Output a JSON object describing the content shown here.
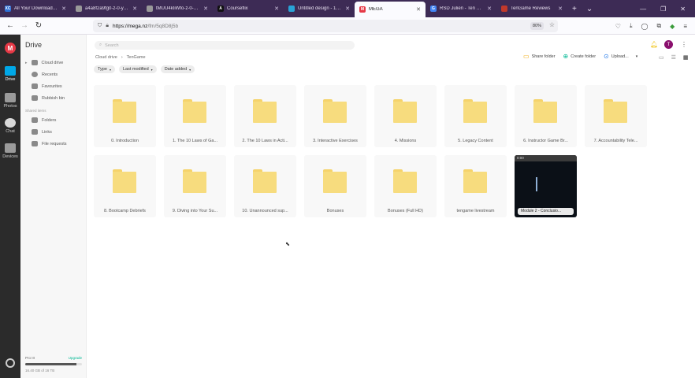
{
  "browser": {
    "tabs": [
      {
        "favicon": "XC",
        "fav_color": "#2c6fd6",
        "title": "All Your Downloadable Eb",
        "active": false
      },
      {
        "favicon": "",
        "fav_color": "#999999",
        "title": "a4a8f2a9fg0-z-0-y-668ad4fa0",
        "active": false
      },
      {
        "favicon": "",
        "fav_color": "#999999",
        "title": "tMUU4kIiWfo-z-0-y-666ad2c",
        "active": false
      },
      {
        "favicon": "A",
        "fav_color": "#111111",
        "title": "Courseflix",
        "active": false
      },
      {
        "favicon": "",
        "fav_color": "#29a3d6",
        "title": "Untitled design - 1200 x",
        "active": false
      },
      {
        "favicon": "M",
        "fav_color": "#e63946",
        "title": "MEGA",
        "active": true
      },
      {
        "favicon": "G",
        "fav_color": "#4285f4",
        "title": "RSD Julien - Ten Game - C",
        "active": false
      },
      {
        "favicon": "",
        "fav_color": "#c0392b",
        "title": "TenGame Reviews",
        "active": false
      }
    ],
    "new_tab": "+",
    "tab_list": "⌄",
    "url_host": "https://mega.nz",
    "url_rest": "/fm/5q8D8j5b",
    "zoom": "80%"
  },
  "rail": {
    "logo": "M",
    "items": [
      {
        "label": "Drive",
        "color": "#00a8e8"
      },
      {
        "label": "Photos",
        "color": "#9a9a9a"
      },
      {
        "label": "Chat",
        "color": "#9a9a9a"
      },
      {
        "label": "Devices",
        "color": "#9a9a9a"
      }
    ]
  },
  "sidebar": {
    "title": "Drive",
    "items": [
      "Cloud drive",
      "Recents",
      "Favourites",
      "Rubbish bin"
    ],
    "shares_label": "Shared items",
    "share_items": [
      "Folders",
      "Links",
      "File requests"
    ],
    "storage_plan": "Pro III",
    "upgrade": "Upgrade",
    "storage_used": "16.40 GB of 16 TB",
    "storage_fill": 0.9
  },
  "topbar": {
    "search_placeholder": "Search",
    "avatar": "T"
  },
  "breadcrumb": [
    "Cloud drive",
    "›",
    "TenGame"
  ],
  "actions": {
    "share_folder": "Share folder",
    "create_folder": "Create folder",
    "upload": "Upload..."
  },
  "filters": [
    "Type",
    "Last modified",
    "Date added"
  ],
  "folders": [
    "0. Introduction",
    "1. The 10 Laws of Ga...",
    "2. The 10 Laws in Acti...",
    "3. Interactive Exercises",
    "4. Missions",
    "5. Legacy Content",
    "6. Instructor Game Br...",
    "7. Accountability Tele...",
    "8. Bootcamp Debriefs",
    "9. Diving into Your Su...",
    "10. Unannounced sup...",
    "Bonuses",
    "Bonuses (Full HD)",
    "tengame livestream"
  ],
  "video_file": {
    "header": "0:00",
    "label": "Module 2 - Conclusio..."
  }
}
